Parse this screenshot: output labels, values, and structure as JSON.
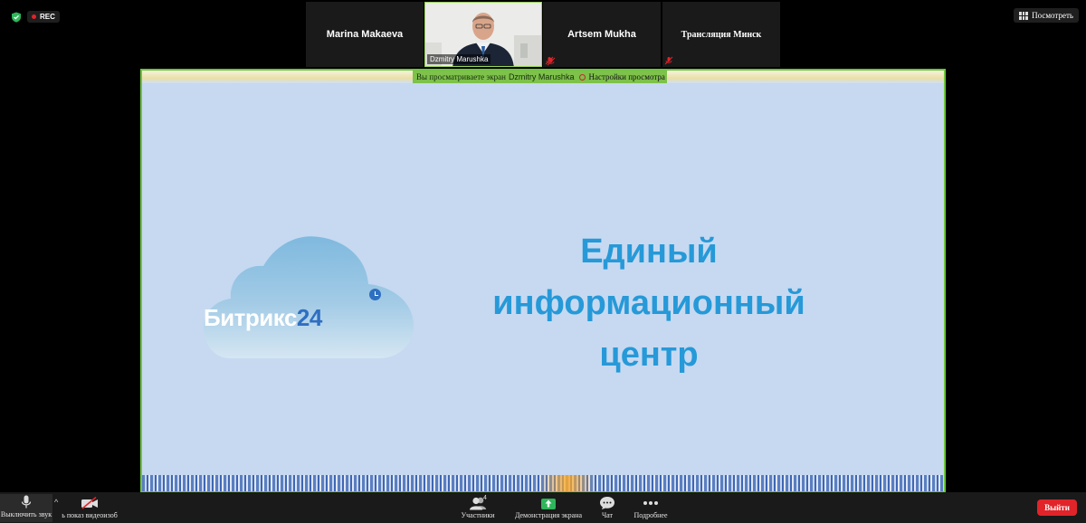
{
  "recording": {
    "label": "REC"
  },
  "participants": [
    {
      "name": "Marina Makaeva"
    },
    {
      "name": "Dzmitry Marushka"
    },
    {
      "name": "Artsem Mukha"
    },
    {
      "name": "Трансляция Минск"
    }
  ],
  "view_button": {
    "label": "Посмотреть"
  },
  "share_banner": {
    "text": "Вы просматриваете экран",
    "sharer": "Dzmitry Marushka",
    "options_label": "Настройки просмотра"
  },
  "slide": {
    "logo_word": "Битрикс",
    "logo_number": "24",
    "headline": [
      "Единый",
      "информационный",
      "центр"
    ]
  },
  "toolbar": {
    "mute_label": "Выключить звук",
    "video_label": "ь показ видеоизоб",
    "participants_label": "Участники",
    "participants_count": "4",
    "share_label": "Демонстрация экрана",
    "chat_label": "Чат",
    "more_label": "Подробнее",
    "leave_label": "Выйти"
  },
  "colors": {
    "accent_green": "#7ec14b",
    "share_border": "#6cc63c",
    "leave_red": "#e0242a",
    "headline_blue": "#2699d8"
  }
}
